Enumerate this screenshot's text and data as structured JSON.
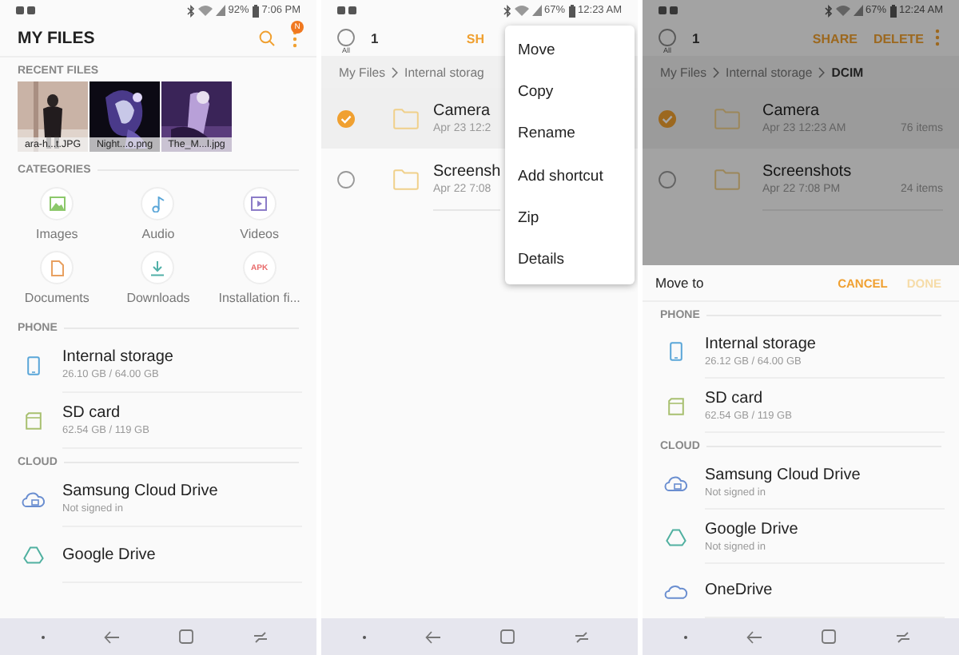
{
  "my_files_screen": {
    "status_bar": {
      "battery": "92%",
      "time": "7:06 PM"
    },
    "title": "MY FILES",
    "notification_badge": "N",
    "recent_files": {
      "label": "RECENT FILES",
      "items": [
        {
          "caption": "ara-h...t.JPG"
        },
        {
          "caption": "Night...o.png"
        },
        {
          "caption": "The_M...l.jpg"
        }
      ]
    },
    "categories": {
      "label": "CATEGORIES",
      "items": [
        {
          "kind": "images",
          "label": "Images",
          "color": "#8cc86a"
        },
        {
          "kind": "audio",
          "label": "Audio",
          "color": "#5aa6d8"
        },
        {
          "kind": "videos",
          "label": "Videos",
          "color": "#8c7cc8"
        },
        {
          "kind": "documents",
          "label": "Documents",
          "color": "#e8a060"
        },
        {
          "kind": "downloads",
          "label": "Downloads",
          "color": "#50b0a8"
        },
        {
          "kind": "apk",
          "label": "Installation fi...",
          "color": "#e86a6a",
          "icon_text": "APK"
        }
      ]
    },
    "phone": {
      "label": "PHONE",
      "items": [
        {
          "kind": "phone",
          "name": "Internal storage",
          "detail": "26.10 GB / 64.00 GB"
        },
        {
          "kind": "sdcard",
          "name": "SD card",
          "detail": "62.54 GB / 119 GB"
        }
      ]
    },
    "cloud": {
      "label": "CLOUD",
      "items": [
        {
          "kind": "samsung-cloud",
          "name": "Samsung Cloud Drive",
          "detail": "Not signed in"
        },
        {
          "kind": "google-drive",
          "name": "Google Drive"
        }
      ]
    }
  },
  "selection_screen": {
    "status_bar": {
      "battery": "67%",
      "time": "12:23 AM"
    },
    "select_all": {
      "label": "All",
      "checked": false
    },
    "selected_count": "1",
    "actions": [
      "SH"
    ],
    "breadcrumb": [
      "My Files",
      "Internal storag"
    ],
    "folders": [
      {
        "name": "Camera",
        "date": "Apr 23 12:2",
        "selected": true
      },
      {
        "name": "Screensh",
        "date": "Apr 22 7:08",
        "selected": false
      }
    ],
    "menu": [
      "Move",
      "Copy",
      "Rename",
      "Add shortcut",
      "Zip",
      "Details"
    ]
  },
  "move_screen": {
    "status_bar": {
      "battery": "67%",
      "time": "12:24 AM"
    },
    "select_all": {
      "label": "All",
      "checked": false
    },
    "selected_count": "1",
    "actions": [
      "SHARE",
      "DELETE"
    ],
    "breadcrumb": [
      "My Files",
      "Internal storage",
      "DCIM"
    ],
    "folders": [
      {
        "name": "Camera",
        "date": "Apr 23 12:23 AM",
        "count": "76 items",
        "selected": true
      },
      {
        "name": "Screenshots",
        "date": "Apr 22 7:08 PM",
        "count": "24 items",
        "selected": false
      }
    ],
    "sheet": {
      "title": "Move to",
      "buttons": [
        {
          "label": "CANCEL",
          "disabled": false
        },
        {
          "label": "DONE",
          "disabled": true
        }
      ],
      "phone": {
        "label": "PHONE",
        "items": [
          {
            "kind": "phone",
            "name": "Internal storage",
            "detail": "26.12 GB / 64.00 GB"
          },
          {
            "kind": "sdcard",
            "name": "SD card",
            "detail": "62.54 GB / 119 GB"
          }
        ]
      },
      "cloud": {
        "label": "CLOUD",
        "items": [
          {
            "kind": "samsung-cloud",
            "name": "Samsung Cloud Drive",
            "detail": "Not signed in"
          },
          {
            "kind": "google-drive",
            "name": "Google Drive",
            "detail": "Not signed in"
          },
          {
            "kind": "onedrive",
            "name": "OneDrive"
          }
        ]
      }
    }
  }
}
